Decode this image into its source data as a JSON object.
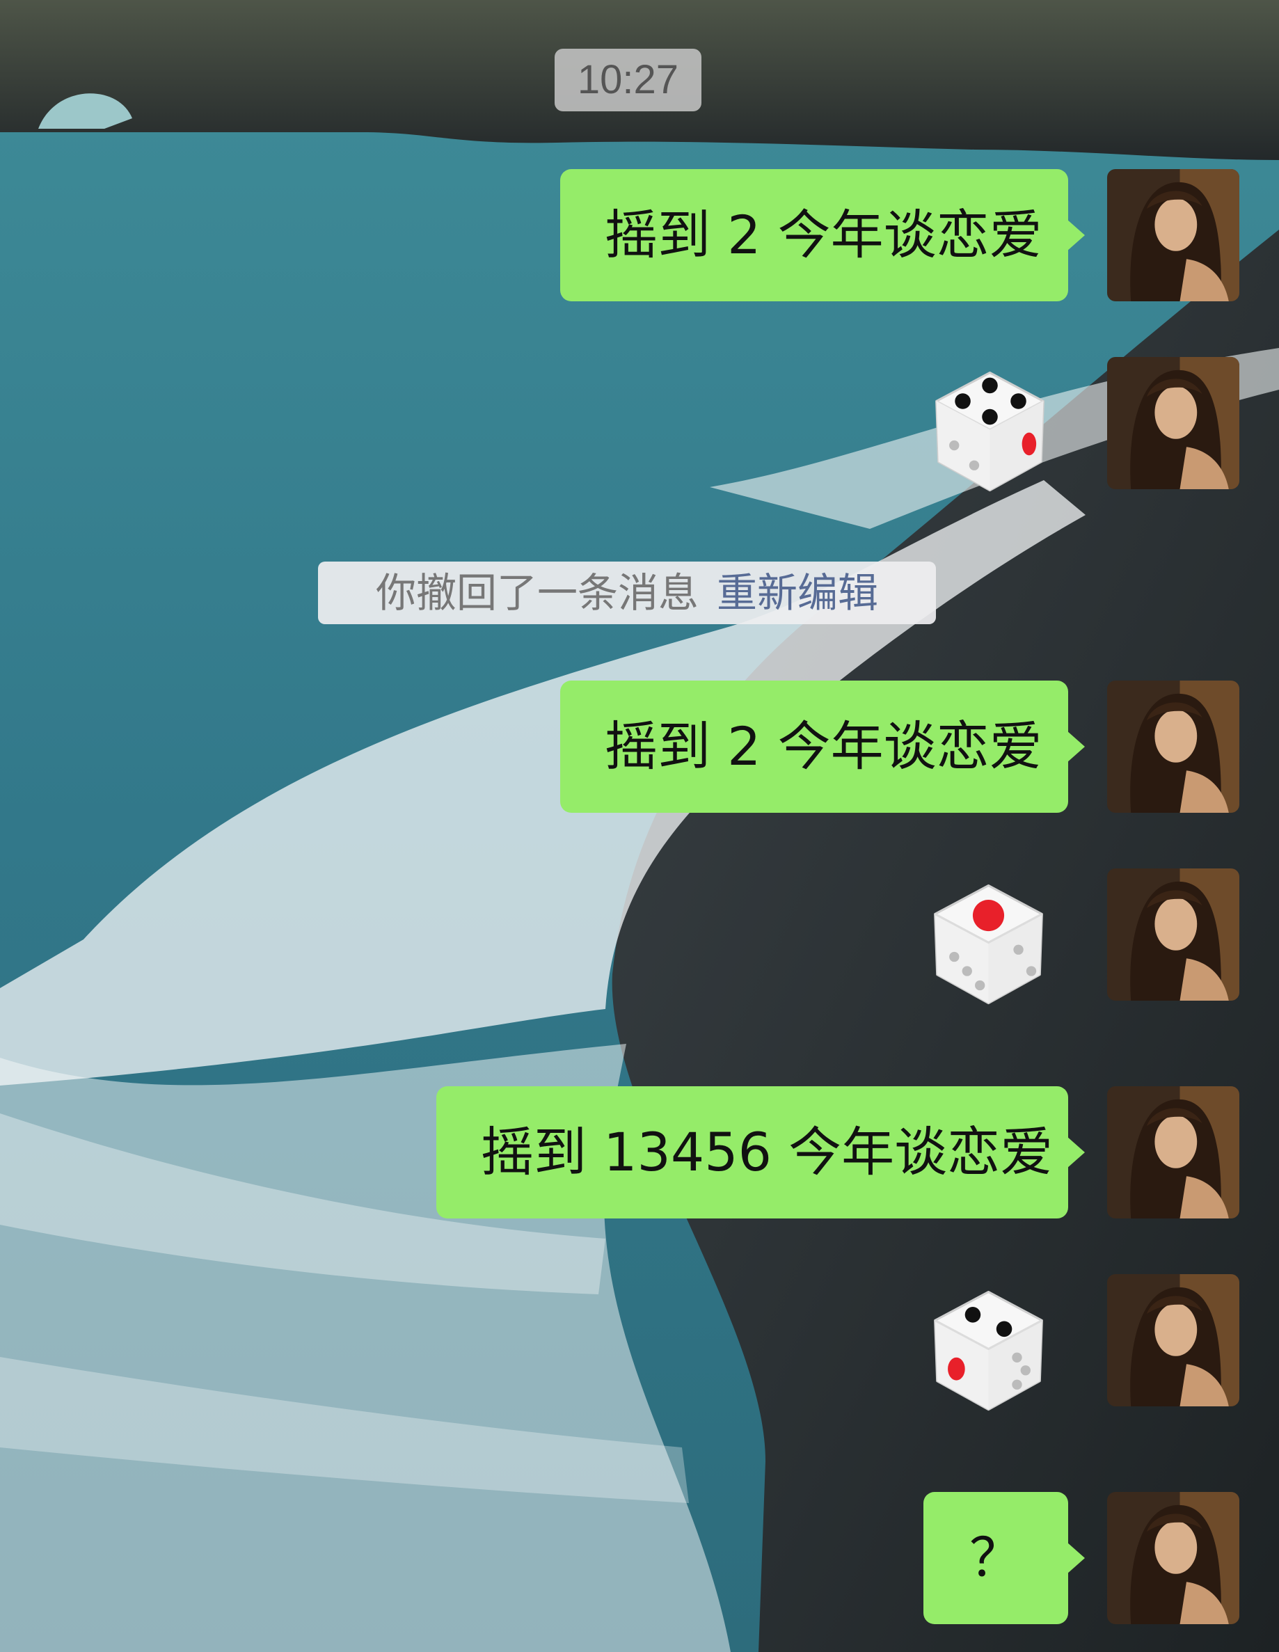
{
  "chat": {
    "timestamp": "10:27",
    "recall_notice": {
      "text": "你撤回了一条消息",
      "action": "重新编辑"
    },
    "messages": [
      {
        "type": "text",
        "text": "摇到 2 今年谈恋爱"
      },
      {
        "type": "dice",
        "value": 4
      },
      {
        "type": "text",
        "text": "摇到 2 今年谈恋爱"
      },
      {
        "type": "dice",
        "value": 1
      },
      {
        "type": "text",
        "text": "摇到 13456 今年谈恋爱"
      },
      {
        "type": "dice",
        "value": 2
      },
      {
        "type": "text",
        "text": "？"
      }
    ]
  },
  "colors": {
    "bubble": "#95ec69",
    "link": "#576b95",
    "pip_red": "#e8202a",
    "pip_black": "#111111"
  }
}
